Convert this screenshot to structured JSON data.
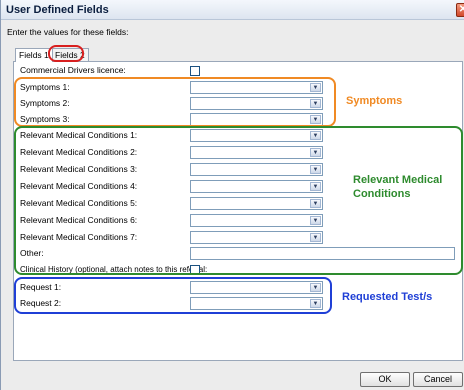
{
  "window": {
    "title": "User Defined Fields",
    "close_glyph": "✕"
  },
  "intro": "Enter the values for these fields:",
  "tabs": [
    {
      "label": "Fields 1"
    },
    {
      "label": "Fields 2"
    }
  ],
  "commercial_drivers": {
    "label": "Commercial Drivers licence:"
  },
  "symptoms": [
    {
      "label": "Symptoms 1:"
    },
    {
      "label": "Symptoms 2:"
    },
    {
      "label": "Symptoms 3:"
    }
  ],
  "conditions": [
    {
      "label": "Relevant Medical Conditions 1:"
    },
    {
      "label": "Relevant Medical Conditions 2:"
    },
    {
      "label": "Relevant Medical Conditions 3:"
    },
    {
      "label": "Relevant Medical Conditions 4:"
    },
    {
      "label": "Relevant Medical Conditions 5:"
    },
    {
      "label": "Relevant Medical Conditions 6:"
    },
    {
      "label": "Relevant Medical Conditions 7:"
    }
  ],
  "other": {
    "label": "Other:"
  },
  "clinical_history": {
    "label": "Clinical History (optional, attach notes to this referral:"
  },
  "requests": [
    {
      "label": "Request 1:"
    },
    {
      "label": "Request 2:"
    }
  ],
  "annotations": {
    "symptoms": "Symptoms",
    "conditions_line1": "Relevant Medical",
    "conditions_line2": "Conditions",
    "requests": "Requested Test/s"
  },
  "buttons": {
    "ok": "OK",
    "cancel": "Cancel"
  },
  "colors": {
    "symptoms": "#f08a24",
    "conditions": "#2e8b2e",
    "requests": "#1f3fd6",
    "tab_highlight": "#d81f1f"
  },
  "icons": {
    "dropdown": "chevron-down-icon",
    "close": "close-icon"
  }
}
